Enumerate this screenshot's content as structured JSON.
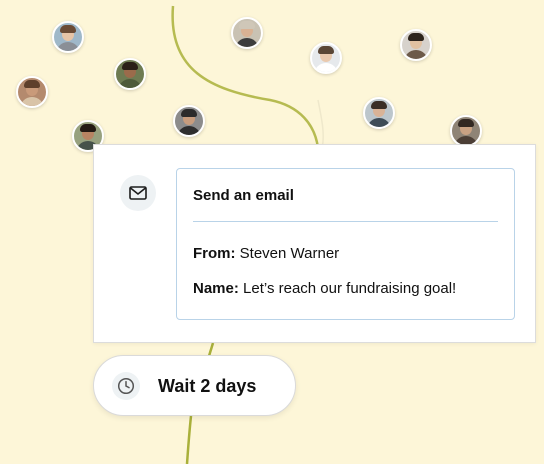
{
  "colors": {
    "background": "#fdf6d8",
    "connector_line": "#a9b03a",
    "card_border": "#b9d3e8",
    "text": "#111111"
  },
  "avatars": [
    {
      "name": "avatar-1"
    },
    {
      "name": "avatar-2"
    },
    {
      "name": "avatar-3"
    },
    {
      "name": "avatar-4"
    },
    {
      "name": "avatar-5"
    },
    {
      "name": "avatar-6"
    },
    {
      "name": "avatar-7"
    },
    {
      "name": "avatar-8"
    },
    {
      "name": "avatar-9"
    },
    {
      "name": "avatar-10"
    }
  ],
  "email_step": {
    "icon": "mail-icon",
    "title": "Send an email",
    "from_label": "From:",
    "from_value": "Steven Warner",
    "name_label": "Name:",
    "name_value": "Let’s reach our fundraising goal!"
  },
  "wait_step": {
    "icon": "clock-icon",
    "label": "Wait 2 days"
  }
}
